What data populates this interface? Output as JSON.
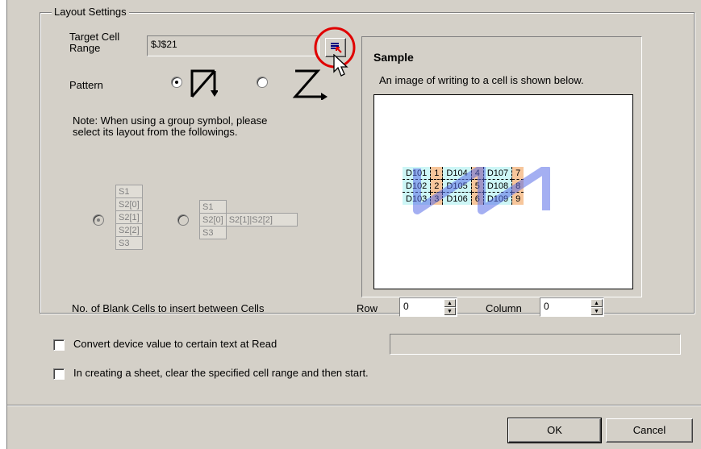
{
  "group_title": "Layout Settings",
  "target_cell": {
    "label_line1": "Target Cell",
    "label_line2": "Range",
    "value": "$J$21"
  },
  "pattern": {
    "label": "Pattern",
    "options": [
      "column-wise",
      "row-wise"
    ],
    "selected": 0
  },
  "note": {
    "line1": "Note: When using a group symbol,  please",
    "line2": "select its layout from the followings."
  },
  "group_layout_vertical": [
    "S1",
    "S2[0]",
    "S2[1]",
    "S2[2]",
    "S3"
  ],
  "group_layout_horizontal": {
    "row1": [
      "S1"
    ],
    "row2": [
      "S2[0]",
      "S2[1]",
      "S2[2]"
    ],
    "row3": [
      "S3"
    ]
  },
  "sample": {
    "title": "Sample",
    "description": "An image of writing to a cell is shown below.",
    "rows": [
      [
        "D101",
        "1",
        "D104",
        "4",
        "D107",
        "7"
      ],
      [
        "D102",
        "2",
        "D105",
        "5",
        "D108",
        "8"
      ],
      [
        "D103",
        "3",
        "D106",
        "6",
        "D109",
        "9"
      ]
    ]
  },
  "blank_cells": {
    "label": "No. of Blank Cells to insert between Cells",
    "row_label": "Row",
    "row_value": "0",
    "column_label": "Column",
    "column_value": "0"
  },
  "convert_option": {
    "label": "Convert device value to certain text at Read",
    "checked": false,
    "text_value": ""
  },
  "clear_option": {
    "label": "In creating a sheet, clear the specified cell range and then start.",
    "checked": false
  },
  "buttons": {
    "ok": "OK",
    "cancel": "Cancel"
  },
  "colors": {
    "dialog_bg": "#d4d0c8",
    "highlight_circle": "#e00000",
    "sample_device_cell": "#cdf6f6",
    "sample_number_cell": "#f7c69b",
    "sample_path": "#5a6ee8"
  },
  "icons": {
    "range_select": "range-select-icon",
    "cursor": "mouse-cursor-icon"
  }
}
